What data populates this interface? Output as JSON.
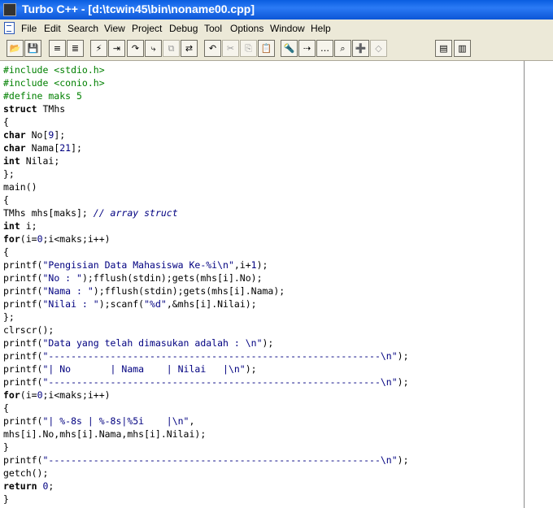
{
  "window": {
    "title": "Turbo C++ - [d:\\tcwin45\\bin\\noname00.cpp]"
  },
  "menu": [
    "File",
    "Edit",
    "Search",
    "View",
    "Project",
    "Debug",
    "Tool",
    "Options",
    "Window",
    "Help"
  ],
  "toolbar": [
    {
      "name": "open-file-icon",
      "glyph": "📂",
      "enabled": true
    },
    {
      "name": "save-file-icon",
      "glyph": "💾",
      "enabled": true
    },
    {
      "name": "save-binary-icon",
      "glyph": "≡",
      "enabled": true
    },
    {
      "name": "find-binary-icon",
      "glyph": "≣",
      "enabled": true
    },
    {
      "name": "make-icon",
      "glyph": "⚡",
      "enabled": true
    },
    {
      "name": "step-into-icon",
      "glyph": "⇥",
      "enabled": true
    },
    {
      "name": "step-over-icon",
      "glyph": "↷",
      "enabled": true
    },
    {
      "name": "trace-icon",
      "glyph": "⤷",
      "enabled": true
    },
    {
      "name": "copy-disabled-icon",
      "glyph": "⧉",
      "enabled": false
    },
    {
      "name": "replace-icon",
      "glyph": "⇄",
      "enabled": true
    },
    {
      "name": "undo-icon",
      "glyph": "↶",
      "enabled": true
    },
    {
      "name": "cut-icon",
      "glyph": "✂",
      "enabled": false
    },
    {
      "name": "copy-icon",
      "glyph": "⎘",
      "enabled": false
    },
    {
      "name": "paste-icon",
      "glyph": "📋",
      "enabled": true
    },
    {
      "name": "search-icon",
      "glyph": "🔦",
      "enabled": true
    },
    {
      "name": "search-replace-icon",
      "glyph": "⇢",
      "enabled": true
    },
    {
      "name": "search-again-icon",
      "glyph": "…",
      "enabled": true
    },
    {
      "name": "find-in-files-icon",
      "glyph": "⌕",
      "enabled": true
    },
    {
      "name": "add-watch-icon",
      "glyph": "➕",
      "enabled": true
    },
    {
      "name": "inspect-icon",
      "glyph": "◇",
      "enabled": false
    },
    {
      "name": "tile-icon",
      "glyph": "▤",
      "enabled": true
    },
    {
      "name": "cascade-icon",
      "glyph": "▥",
      "enabled": true
    }
  ],
  "editor": {
    "lines": [
      [
        [
          "pp",
          "#include <stdio.h>"
        ]
      ],
      [
        [
          "pp",
          "#include <conio.h>"
        ]
      ],
      [
        [
          "pp",
          "#define maks 5"
        ]
      ],
      [
        [
          "k",
          "struct"
        ],
        [
          "p",
          " TMhs"
        ]
      ],
      [
        [
          "p",
          "{"
        ]
      ],
      [
        [
          "k",
          "char"
        ],
        [
          "p",
          " No["
        ],
        [
          "n",
          "9"
        ],
        [
          "p",
          "];"
        ]
      ],
      [
        [
          "k",
          "char"
        ],
        [
          "p",
          " Nama["
        ],
        [
          "n",
          "21"
        ],
        [
          "p",
          "];"
        ]
      ],
      [
        [
          "k",
          "int"
        ],
        [
          "p",
          " Nilai;"
        ]
      ],
      [
        [
          "p",
          "};"
        ]
      ],
      [
        [
          "p",
          "main()"
        ]
      ],
      [
        [
          "p",
          "{"
        ]
      ],
      [
        [
          "p",
          "TMhs mhs[maks]; "
        ],
        [
          "c",
          "// array struct"
        ]
      ],
      [
        [
          "k",
          "int"
        ],
        [
          "p",
          " i;"
        ]
      ],
      [
        [
          "k",
          "for"
        ],
        [
          "p",
          "(i="
        ],
        [
          "n",
          "0"
        ],
        [
          "p",
          ";i<maks;i++)"
        ]
      ],
      [
        [
          "p",
          "{"
        ]
      ],
      [
        [
          "p",
          "printf("
        ],
        [
          "s",
          "\"Pengisian Data Mahasiswa Ke-%i\\n\""
        ],
        [
          "p",
          ",i+"
        ],
        [
          "n",
          "1"
        ],
        [
          "p",
          ");"
        ]
      ],
      [
        [
          "p",
          "printf("
        ],
        [
          "s",
          "\"No : \""
        ],
        [
          "p",
          ");fflush(stdin);gets(mhs[i].No);"
        ]
      ],
      [
        [
          "p",
          "printf("
        ],
        [
          "s",
          "\"Nama : \""
        ],
        [
          "p",
          ");fflush(stdin);gets(mhs[i].Nama);"
        ]
      ],
      [
        [
          "p",
          "printf("
        ],
        [
          "s",
          "\"Nilai : \""
        ],
        [
          "p",
          ");scanf("
        ],
        [
          "s",
          "\"%d\""
        ],
        [
          "p",
          ",&mhs[i].Nilai);"
        ]
      ],
      [
        [
          "p",
          "};"
        ]
      ],
      [
        [
          "p",
          "clrscr();"
        ]
      ],
      [
        [
          "p",
          "printf("
        ],
        [
          "s",
          "\"Data yang telah dimasukan adalah : \\n\""
        ],
        [
          "p",
          ");"
        ]
      ],
      [
        [
          "p",
          "printf("
        ],
        [
          "s",
          "\"-----------------------------------------------------------\\n\""
        ],
        [
          "p",
          ");"
        ]
      ],
      [
        [
          "p",
          "printf("
        ],
        [
          "s",
          "\"| No       | Nama    | Nilai   |\\n\""
        ],
        [
          "p",
          ");"
        ]
      ],
      [
        [
          "p",
          "printf("
        ],
        [
          "s",
          "\"-----------------------------------------------------------\\n\""
        ],
        [
          "p",
          ");"
        ]
      ],
      [
        [
          "k",
          "for"
        ],
        [
          "p",
          "(i="
        ],
        [
          "n",
          "0"
        ],
        [
          "p",
          ";i<maks;i++)"
        ]
      ],
      [
        [
          "p",
          "{"
        ]
      ],
      [
        [
          "p",
          "printf("
        ],
        [
          "s",
          "\"| %-8s | %-8s|%5i    |\\n\""
        ],
        [
          "p",
          ","
        ]
      ],
      [
        [
          "p",
          "mhs[i].No,mhs[i].Nama,mhs[i].Nilai);"
        ]
      ],
      [
        [
          "p",
          "}"
        ]
      ],
      [
        [
          "p",
          "printf("
        ],
        [
          "s",
          "\"-----------------------------------------------------------\\n\""
        ],
        [
          "p",
          ");"
        ]
      ],
      [
        [
          "p",
          "getch();"
        ]
      ],
      [
        [
          "k",
          "return"
        ],
        [
          "p",
          " "
        ],
        [
          "n",
          "0"
        ],
        [
          "p",
          ";"
        ]
      ],
      [
        [
          "p",
          "}"
        ]
      ]
    ]
  }
}
